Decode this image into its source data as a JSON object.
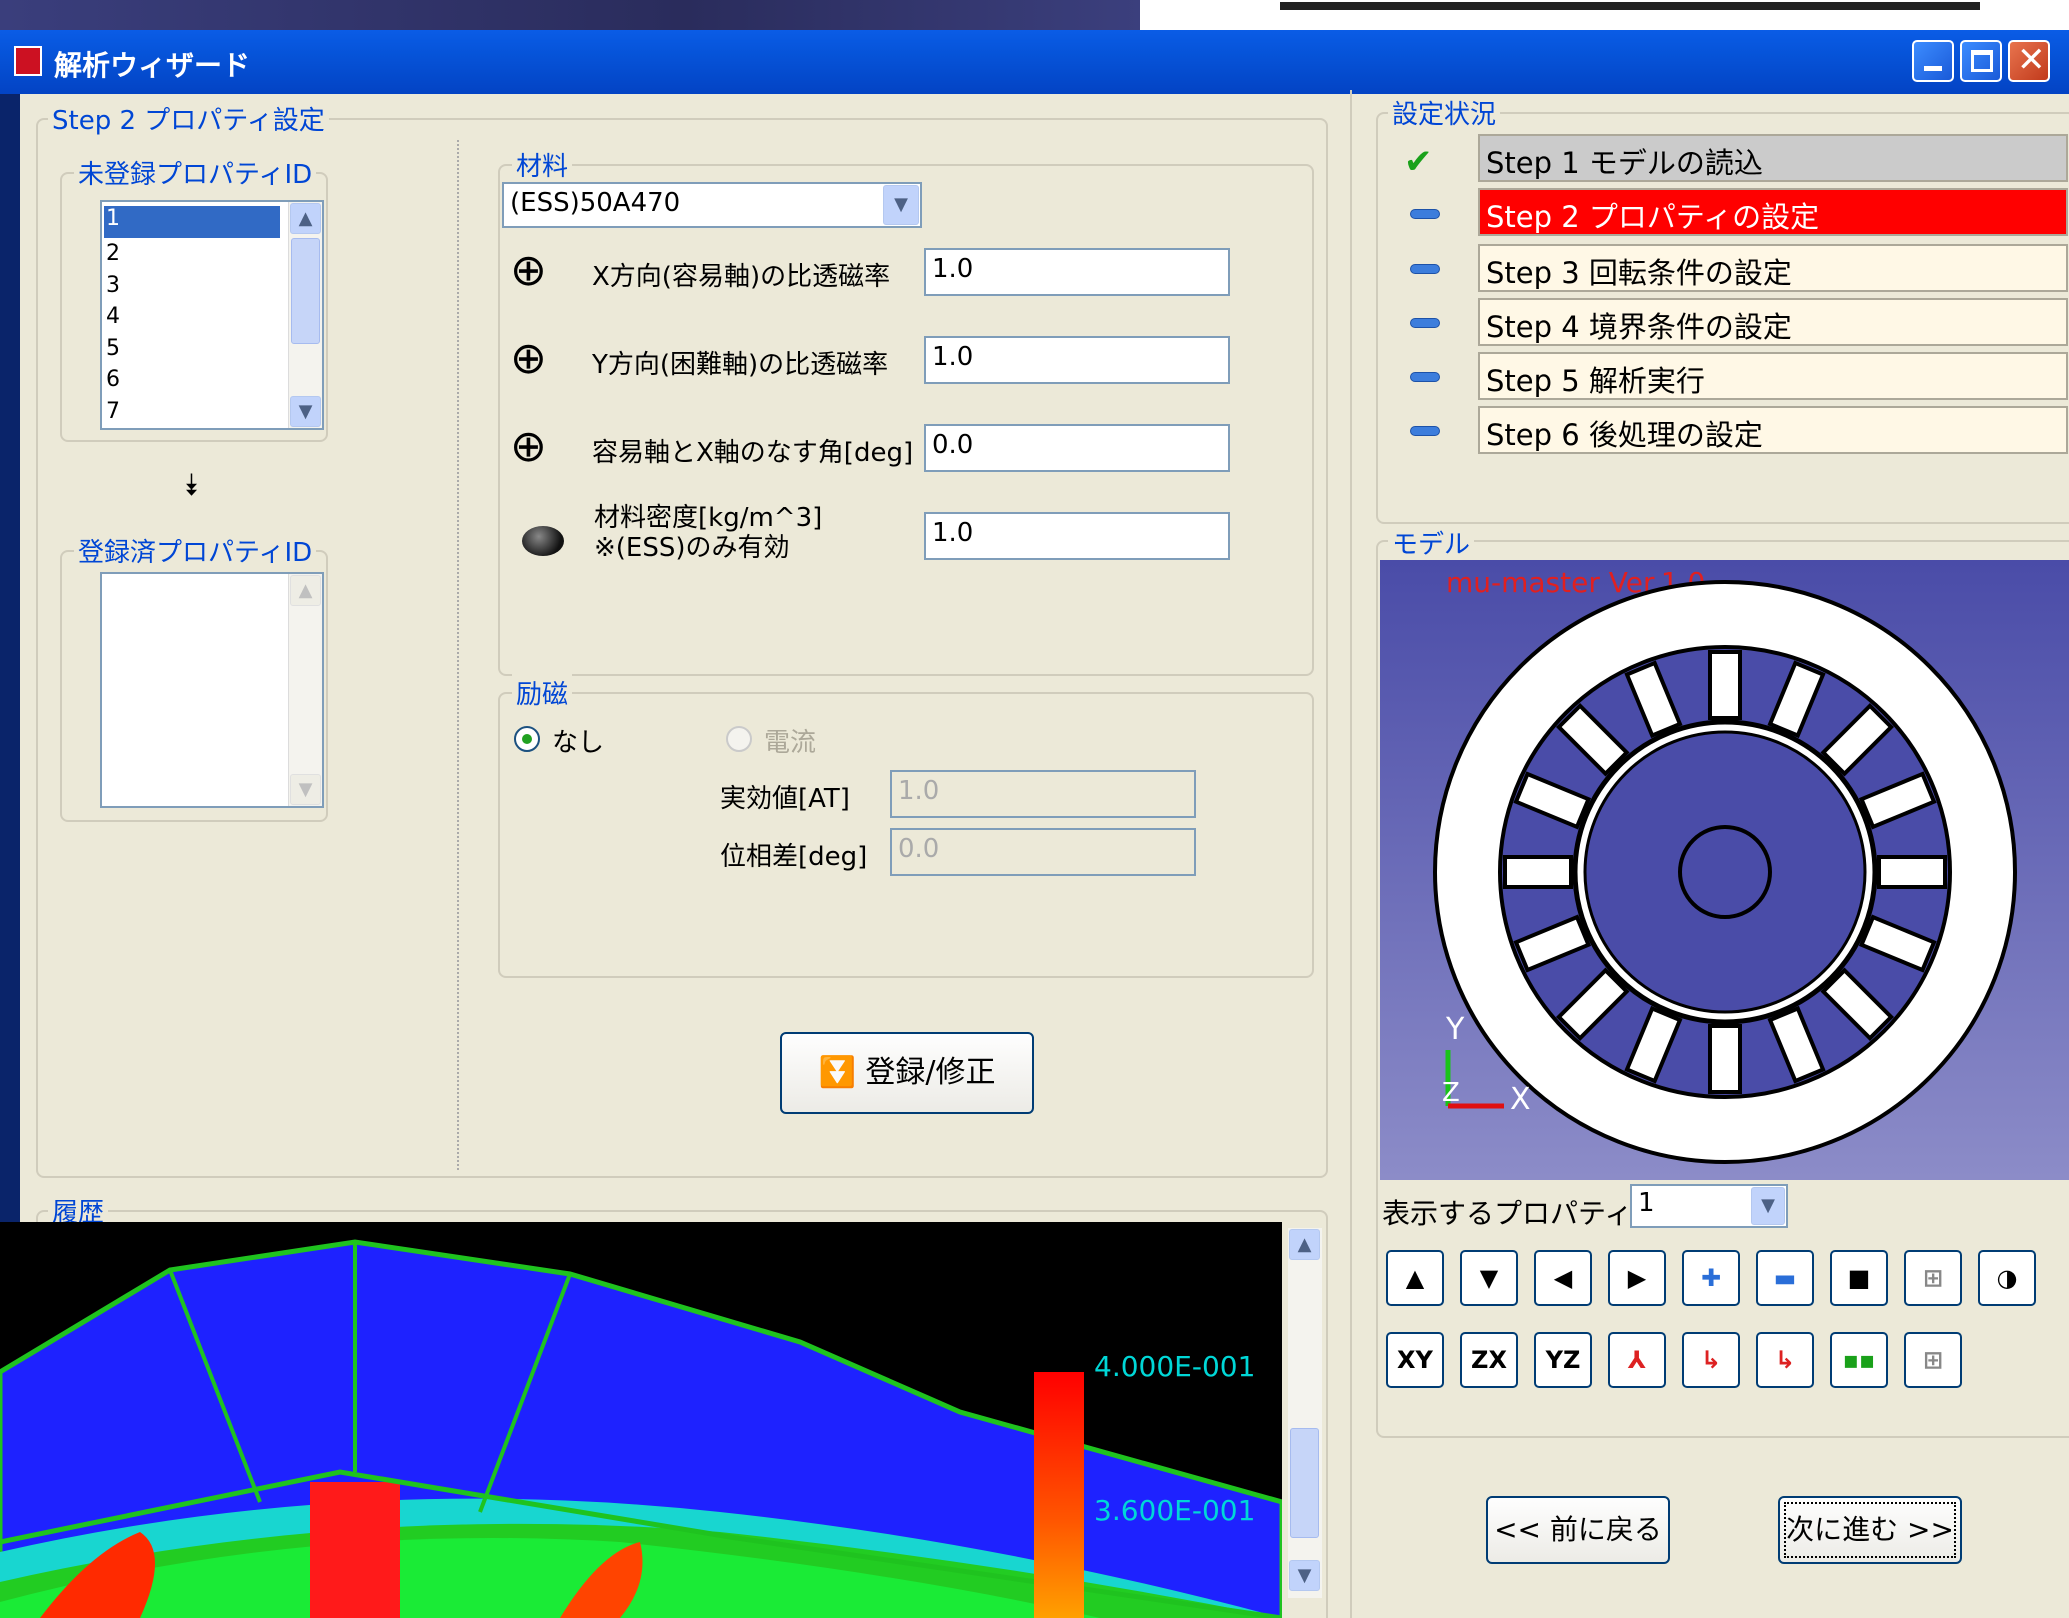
{
  "window": {
    "title": "解析ウィザード"
  },
  "left": {
    "step_group": "Step 2 プロパティ設定",
    "unregistered_label": "未登録プロパティID",
    "unregistered_items": [
      "1",
      "2",
      "3",
      "4",
      "5",
      "6",
      "7"
    ],
    "registered_label": "登録済プロパティID",
    "material": {
      "label": "材料",
      "selected": "(ESS)50A470",
      "x_perm_label": "X方向(容易軸)の比透磁率",
      "x_perm_value": "1.0",
      "y_perm_label": "Y方向(困難軸)の比透磁率",
      "y_perm_value": "1.0",
      "angle_label": "容易軸とX軸のなす角[deg]",
      "angle_value": "0.0",
      "density_label": "材料密度[kg/m^3]",
      "density_note": "※(ESS)のみ有効",
      "density_value": "1.0"
    },
    "excitation": {
      "label": "励磁",
      "none": "なし",
      "current": "電流",
      "rms_label": "実効値[AT]",
      "rms_value": "1.0",
      "phase_label": "位相差[deg]",
      "phase_value": "0.0"
    },
    "register_button": "登録/修正",
    "history_label": "履歴"
  },
  "right": {
    "status_label": "設定状況",
    "steps": [
      "Step 1 モデルの読込",
      "Step 2 プロパティの設定",
      "Step 3 回転条件の設定",
      "Step 4 境界条件の設定",
      "Step 5 解析実行",
      "Step 6 後処理の設定"
    ],
    "model_label": "モデル",
    "viewer_caption": "mu-master Ver.1.0",
    "axis_y": "Y",
    "axis_z": "Z",
    "axis_x": "X",
    "display_prop_label": "表示するプロパティID",
    "display_prop_value": "1",
    "view_buttons": [
      "XY",
      "ZX",
      "YZ"
    ],
    "back_button": "<< 前に戻る",
    "next_button": "次に進む >>"
  },
  "overlay": {
    "legend_top": "4.000E-001",
    "legend_mid": "3.600E-001"
  },
  "colors": {
    "active_step": "#ff0000",
    "done_step": "#c8c8c8",
    "viewer_bg": "#5a5aa8"
  }
}
